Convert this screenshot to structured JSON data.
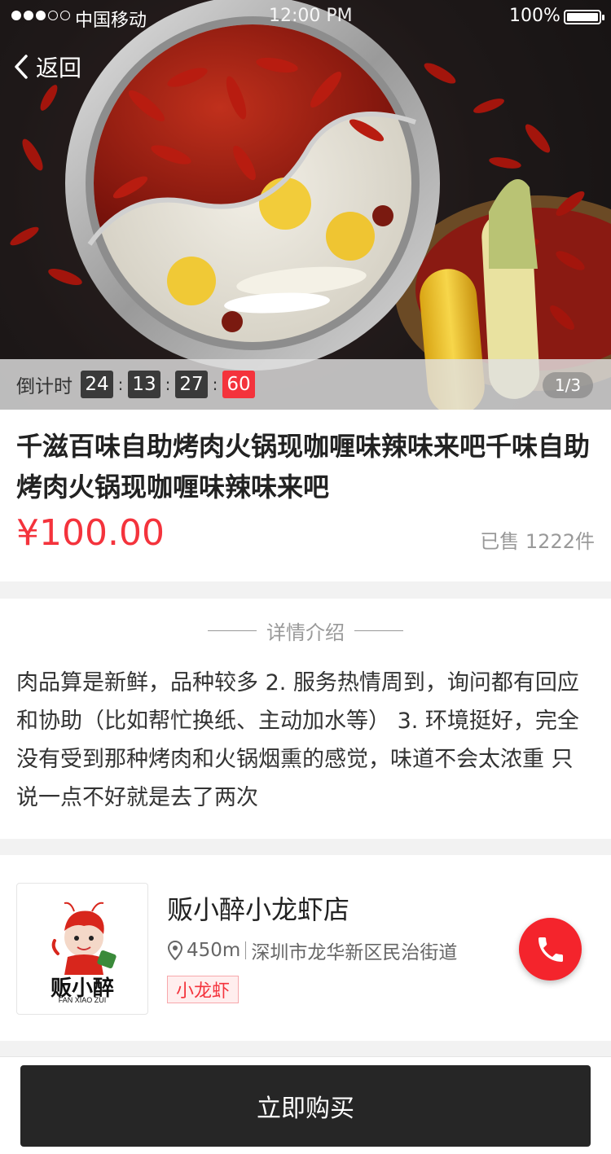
{
  "status_bar": {
    "carrier": "中国移动",
    "time": "12:00 PM",
    "battery": "100%",
    "signal_bars": 3,
    "signal_total": 5
  },
  "header": {
    "back_label": "返回",
    "back_icon": "chevron-left-icon"
  },
  "hero": {
    "countdown_label": "倒计时",
    "countdown": [
      "24",
      "13",
      "27",
      "60"
    ],
    "pager": "1/3"
  },
  "product": {
    "title": "千滋百味自助烤肉火锅现咖喱味辣味来吧千味自助烤肉火锅现咖喱味辣味来吧",
    "price": "¥100.00",
    "sold": "已售 1222件"
  },
  "detail": {
    "heading": "详情介绍",
    "text": "肉品算是新鲜，品种较多 2. 服务热情周到，询问都有回应和协助（比如帮忙换纸、主动加水等） 3. 环境挺好，完全没有受到那种烤肉和火锅烟熏的感觉，味道不会太浓重 只说一点不好就是去了两次"
  },
  "shop": {
    "logo_cn": "贩小醉",
    "logo_en": "FAN XIAO ZUI",
    "name": "贩小醉小龙虾店",
    "distance": "450m",
    "address": "深圳市龙华新区民治街道",
    "tag": "小龙虾",
    "location_icon": "location-pin-icon",
    "call_icon": "phone-icon"
  },
  "actions": {
    "buy_label": "立即购买"
  },
  "colors": {
    "accent": "#f4333c",
    "button_dark": "#262626"
  }
}
